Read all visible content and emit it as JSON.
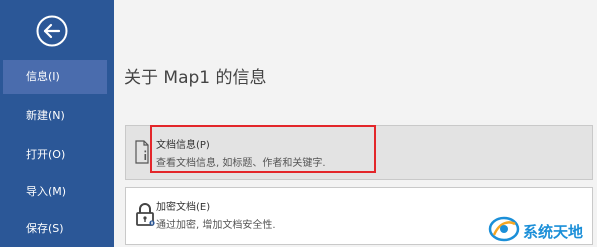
{
  "sidebar": {
    "back_icon": "back-arrow-icon",
    "items": [
      {
        "label": "信息(I)",
        "active": true
      },
      {
        "label": "新建(N)",
        "active": false
      },
      {
        "label": "打开(O)",
        "active": false
      },
      {
        "label": "导入(M)",
        "active": false
      },
      {
        "label": "保存(S)",
        "active": false
      }
    ]
  },
  "main": {
    "title": "关于 Map1 的信息",
    "cards": [
      {
        "title": "文档信息(P)",
        "description": "查看文档信息, 如标题、作者和关键字.",
        "icon": "document-info-icon"
      },
      {
        "title": "加密文档(E)",
        "description": "通过加密, 增加文档安全性.",
        "icon": "lock-icon"
      }
    ]
  },
  "watermark": {
    "text": "系统天地"
  },
  "colors": {
    "sidebar_bg": "#2b5797",
    "sidebar_active": "#4a6cad",
    "highlight": "#e3262a",
    "watermark": "#1b8fd8"
  }
}
